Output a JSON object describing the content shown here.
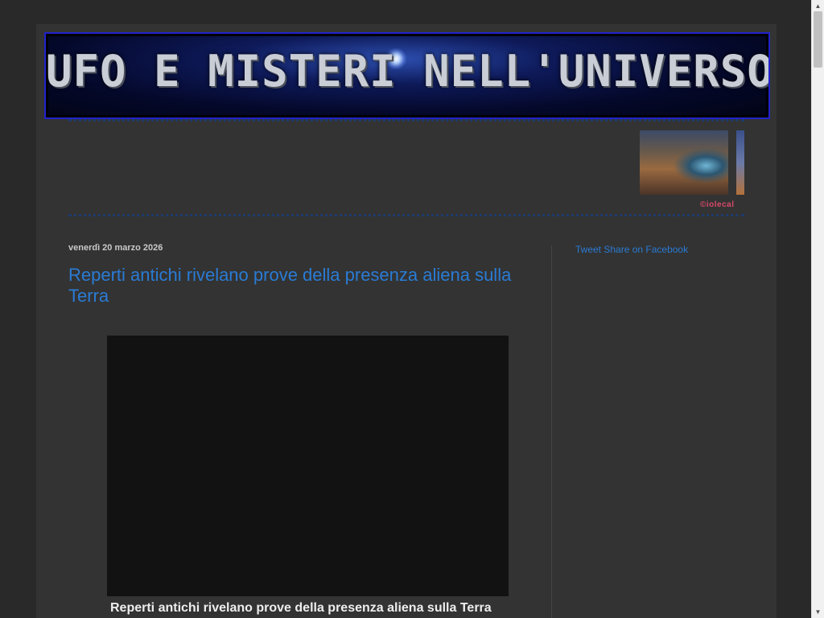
{
  "header": {
    "title": "UFO E MISTERI NELL'UNIVERSO",
    "watermark": "©iolecal"
  },
  "post": {
    "date": "venerdì 20 marzo 2026",
    "title": "Reperti antichi rivelano prove della presenza aliena sulla Terra",
    "caption": "Reperti antichi rivelano prove della presenza aliena sulla Terra"
  },
  "sidebar": {
    "tweet_label": "Tweet",
    "share_label": "Share on Facebook"
  },
  "colors": {
    "background": "#292929",
    "content": "#333333",
    "link": "#2a7bd4",
    "banner_border": "#2222cc"
  }
}
